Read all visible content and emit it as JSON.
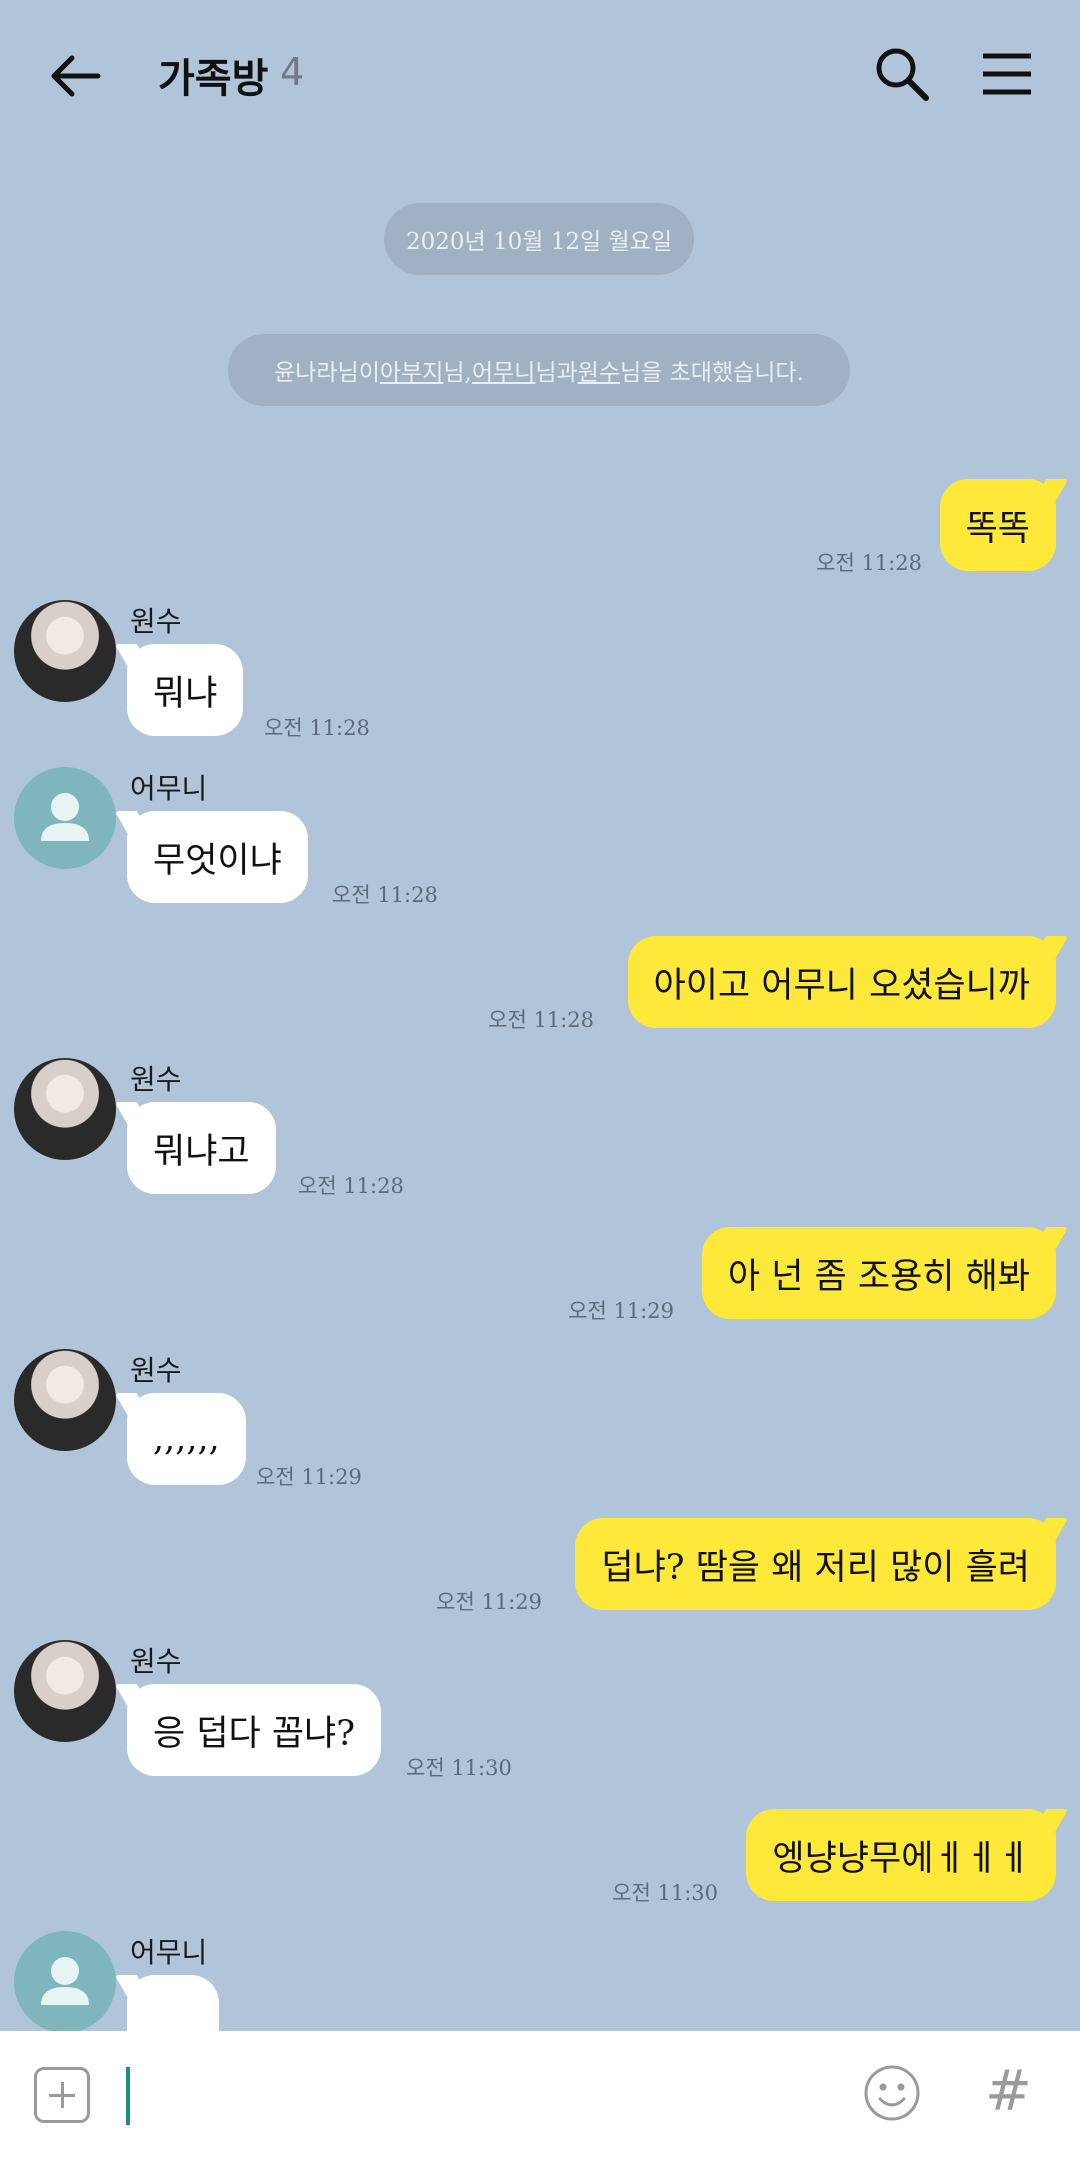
{
  "header": {
    "back_icon": "arrow-left-icon",
    "title": "가족방",
    "member_count": "4",
    "search_icon": "search-icon",
    "menu_icon": "hamburger-menu-icon"
  },
  "system": {
    "date": "2020년 10월 12일 월요일",
    "invite": {
      "inviter": "윤나라님이 ",
      "name1": "아부지",
      "sep1": "님, ",
      "name2": "어무니",
      "sep2": "님과 ",
      "name3": "원수",
      "tail": "님을 초대했습니다."
    }
  },
  "messages": [
    {
      "direction": "out",
      "text": "똑똑",
      "time": "오전 11:28"
    },
    {
      "direction": "in",
      "sender": "원수",
      "avatar": "photo",
      "text": "뭐냐",
      "time": "오전 11:28"
    },
    {
      "direction": "in",
      "sender": "어무니",
      "avatar": "default-person",
      "text": "무엇이냐",
      "time": "오전 11:28"
    },
    {
      "direction": "out",
      "text": "아이고 어무니 오셨습니까",
      "time": "오전 11:28"
    },
    {
      "direction": "in",
      "sender": "원수",
      "avatar": "photo",
      "text": "뭐냐고",
      "time": "오전 11:28"
    },
    {
      "direction": "out",
      "text": "아 넌 좀 조용히 해봐",
      "time": "오전 11:29"
    },
    {
      "direction": "in",
      "sender": "원수",
      "avatar": "photo",
      "text": ",,,,,,",
      "time": "오전 11:29"
    },
    {
      "direction": "out",
      "text": "덥냐? 땀을 왜 저리 많이 흘려",
      "time": "오전 11:29"
    },
    {
      "direction": "in",
      "sender": "원수",
      "avatar": "photo",
      "text": "응 덥다 꼽냐?",
      "time": "오전 11:30"
    },
    {
      "direction": "out",
      "text": "엥냥냥무에ㅔㅔㅔ",
      "time": "오전 11:30"
    },
    {
      "direction": "in",
      "sender": "어무니",
      "avatar": "default-person",
      "text": "",
      "time": ""
    }
  ],
  "input": {
    "value": "",
    "plus_icon": "plus-icon",
    "emoji_icon": "smiley-icon",
    "hash_label": "#"
  },
  "colors": {
    "background": "#b0c5da",
    "outgoing_bubble": "#fee83a",
    "incoming_bubble": "#ffffff",
    "system_pill": "#9fb1c3"
  }
}
